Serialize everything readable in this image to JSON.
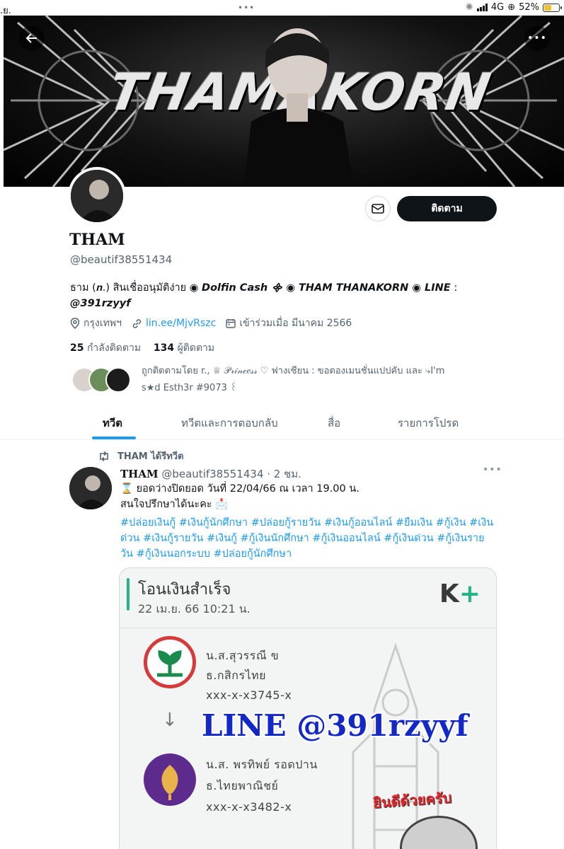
{
  "status_bar": {
    "left": ".ย.",
    "dots": "•••",
    "network": "4G",
    "battery_pct": "52%",
    "battery_level": 0.52
  },
  "banner": {
    "title": "THAMAKORN"
  },
  "profile": {
    "name": "THAM",
    "handle": "@beautif38551434",
    "follow_label": "ติดตาม",
    "bio_line1_plain": "ธาม (𝒏.) สินเชื่ออนุมัติง่าย ◉ ",
    "bio_line1_bold": "Dolfin Cash ᯽ ◉ THAM THANAKORN ◉ LINE",
    "bio_line1_tail": " :",
    "bio_line2": "@391rzyyf",
    "location": "กรุงเทพฯ",
    "link": "lin.ee/MjvRszc",
    "joined": "เข้าร่วมเมื่อ มีนาคม 2566",
    "following_count": "25",
    "following_label": "กำลังติดตาม",
    "followers_count": "134",
    "followers_label": "ผู้ติดตาม",
    "followed_by_line1": "ถูกติดตามโดย r., ♕ 𝒫𝓇𝒾𝓃𝒸𝑒𝓈𝓈 ♡ ฟางเซียน : ขอตองเมนชั่นแปปคับ และ ⤷I'm",
    "followed_by_line2": "s★d Esth3r #9073 ꒰"
  },
  "tabs": [
    {
      "label": "ทวีต"
    },
    {
      "label": "ทวีตและการตอบกลับ"
    },
    {
      "label": "สื่อ"
    },
    {
      "label": "รายการโปรด"
    }
  ],
  "tweet": {
    "retweeted_by": "THAM ได้รีทวีต",
    "author": "THAM",
    "handle_time": "@beautif38551434 · 2 ชม.",
    "line1": "⌛ ยอดว่างปิดยอด วันที่ 22/04/66  ณ เวลา 19.00 น.",
    "line2": "สนใจปรึกษาได้นะคะ 📩",
    "hashtags": "#ปล่อยเงินกู้ #เงินกู้นักศึกษา #ปล่อยกู้รายวัน #เงินกู้ออนไลน์ #ยืมเงิน #กู้เงิน #เงินด่วน #เงินกู้รายวัน #เงินกู้ #กู้เงินนักศึกษา #กู้เงินออนไลน์ #กู้เงินด่วน #กู้เงินรายวัน #กู้เงินนอกระบบ #ปล่อยกู้นักศึกษา"
  },
  "media": {
    "title": "โอนเงินสำเร็จ",
    "date": "22 เม.ย. 66   10:21 น.",
    "logo_k": "K",
    "logo_plus": "+",
    "from_name": "น.ส.สุวรรณี ข",
    "from_bank": "ธ.กสิกรไทย",
    "from_acct": "xxx-x-x3745-x",
    "arrow": "↓",
    "line_id": "LINE @391rzyyf",
    "to_name": "น.ส. พรทิพย์ รอดปาน",
    "to_bank": "ธ.ไทยพาณิชย์",
    "to_acct": "xxx-x-x3482-x",
    "sticker": "ยินดีด้วยครับ"
  },
  "colors": {
    "accent": "#1d9bf0",
    "text": "#0f1419",
    "muted": "#536471",
    "kbank_green": "#27b38a",
    "line_blue": "#1428c8"
  }
}
